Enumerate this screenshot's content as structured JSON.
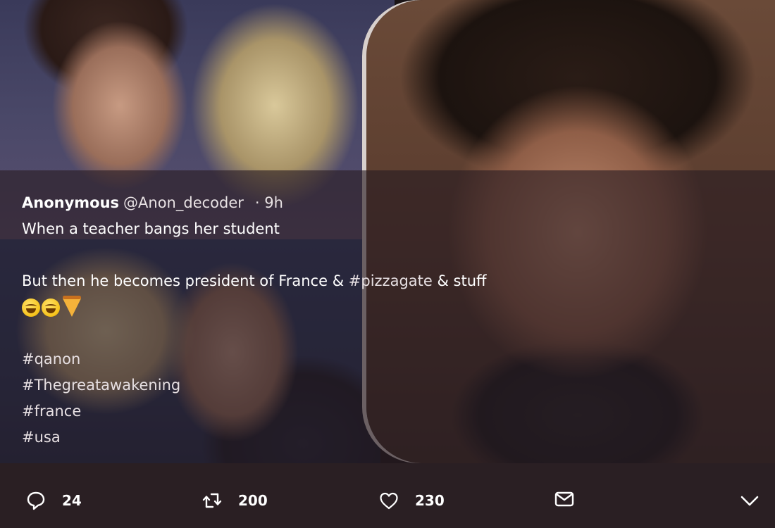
{
  "tweet": {
    "author_name": "Anonymous",
    "author_handle": "@Anon_decoder",
    "timestamp": "· 9h",
    "line1": "When a teacher bangs her student",
    "line2_before": "But then he becomes president of France & ",
    "line2_hashtag": "#pizzagate",
    "line2_after": " & stuff",
    "emojis": [
      "grinning-squinting-face-emoji",
      "grinning-squinting-face-emoji",
      "pizza-emoji"
    ],
    "hashtags": [
      "#qanon",
      "#Thegreatawakening",
      "#france",
      "#usa"
    ]
  },
  "actions": {
    "reply_count": "24",
    "retweet_count": "200",
    "like_count": "230"
  },
  "icons": {
    "reply": "reply-icon",
    "retweet": "retweet-icon",
    "like": "heart-icon",
    "share": "envelope-icon",
    "more": "chevron-down-icon"
  },
  "colors": {
    "background": "#2a1f23",
    "text": "#ffffff"
  }
}
